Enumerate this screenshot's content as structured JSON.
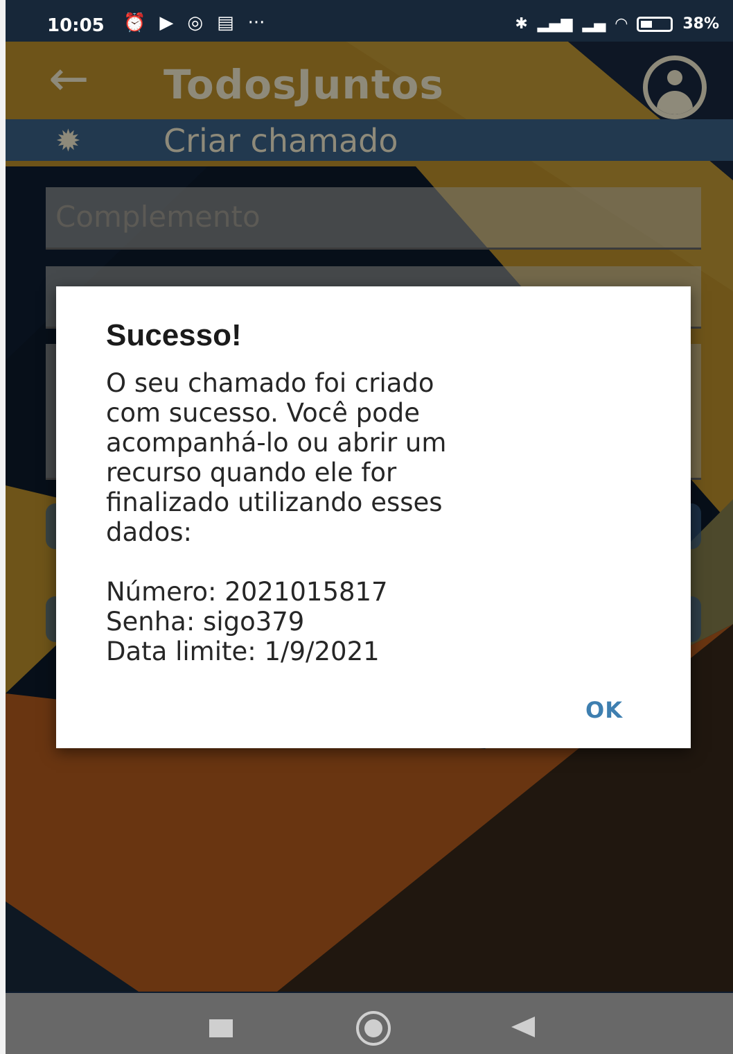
{
  "status_bar": {
    "time": "10:05",
    "left_icons": [
      "alarm-icon",
      "youtube-icon",
      "chrome-icon",
      "calendar-icon",
      "more-icon"
    ],
    "more_symbol": "···",
    "battery": "38%"
  },
  "app_bar": {
    "title": "TodosJuntos",
    "back_symbol": "←"
  },
  "section": {
    "title": "Criar chamado",
    "icon_symbol": "✹"
  },
  "form": {
    "complemento_placeholder": "Complemento"
  },
  "dialog": {
    "title": "Sucesso!",
    "body": "O seu chamado foi criado\ncom sucesso. Você pode\nacompanhá-lo ou abrir um\nrecurso quando ele for\nfinalizado utilizando esses\ndados:\n\nNúmero: 2021015817\nSenha: sigo379\nData limite: 1/9/2021",
    "ok_label": "OK"
  },
  "colors": {
    "accent": "#3e7fb0",
    "header_bar": "#22394f",
    "status_bar": "#172739"
  }
}
